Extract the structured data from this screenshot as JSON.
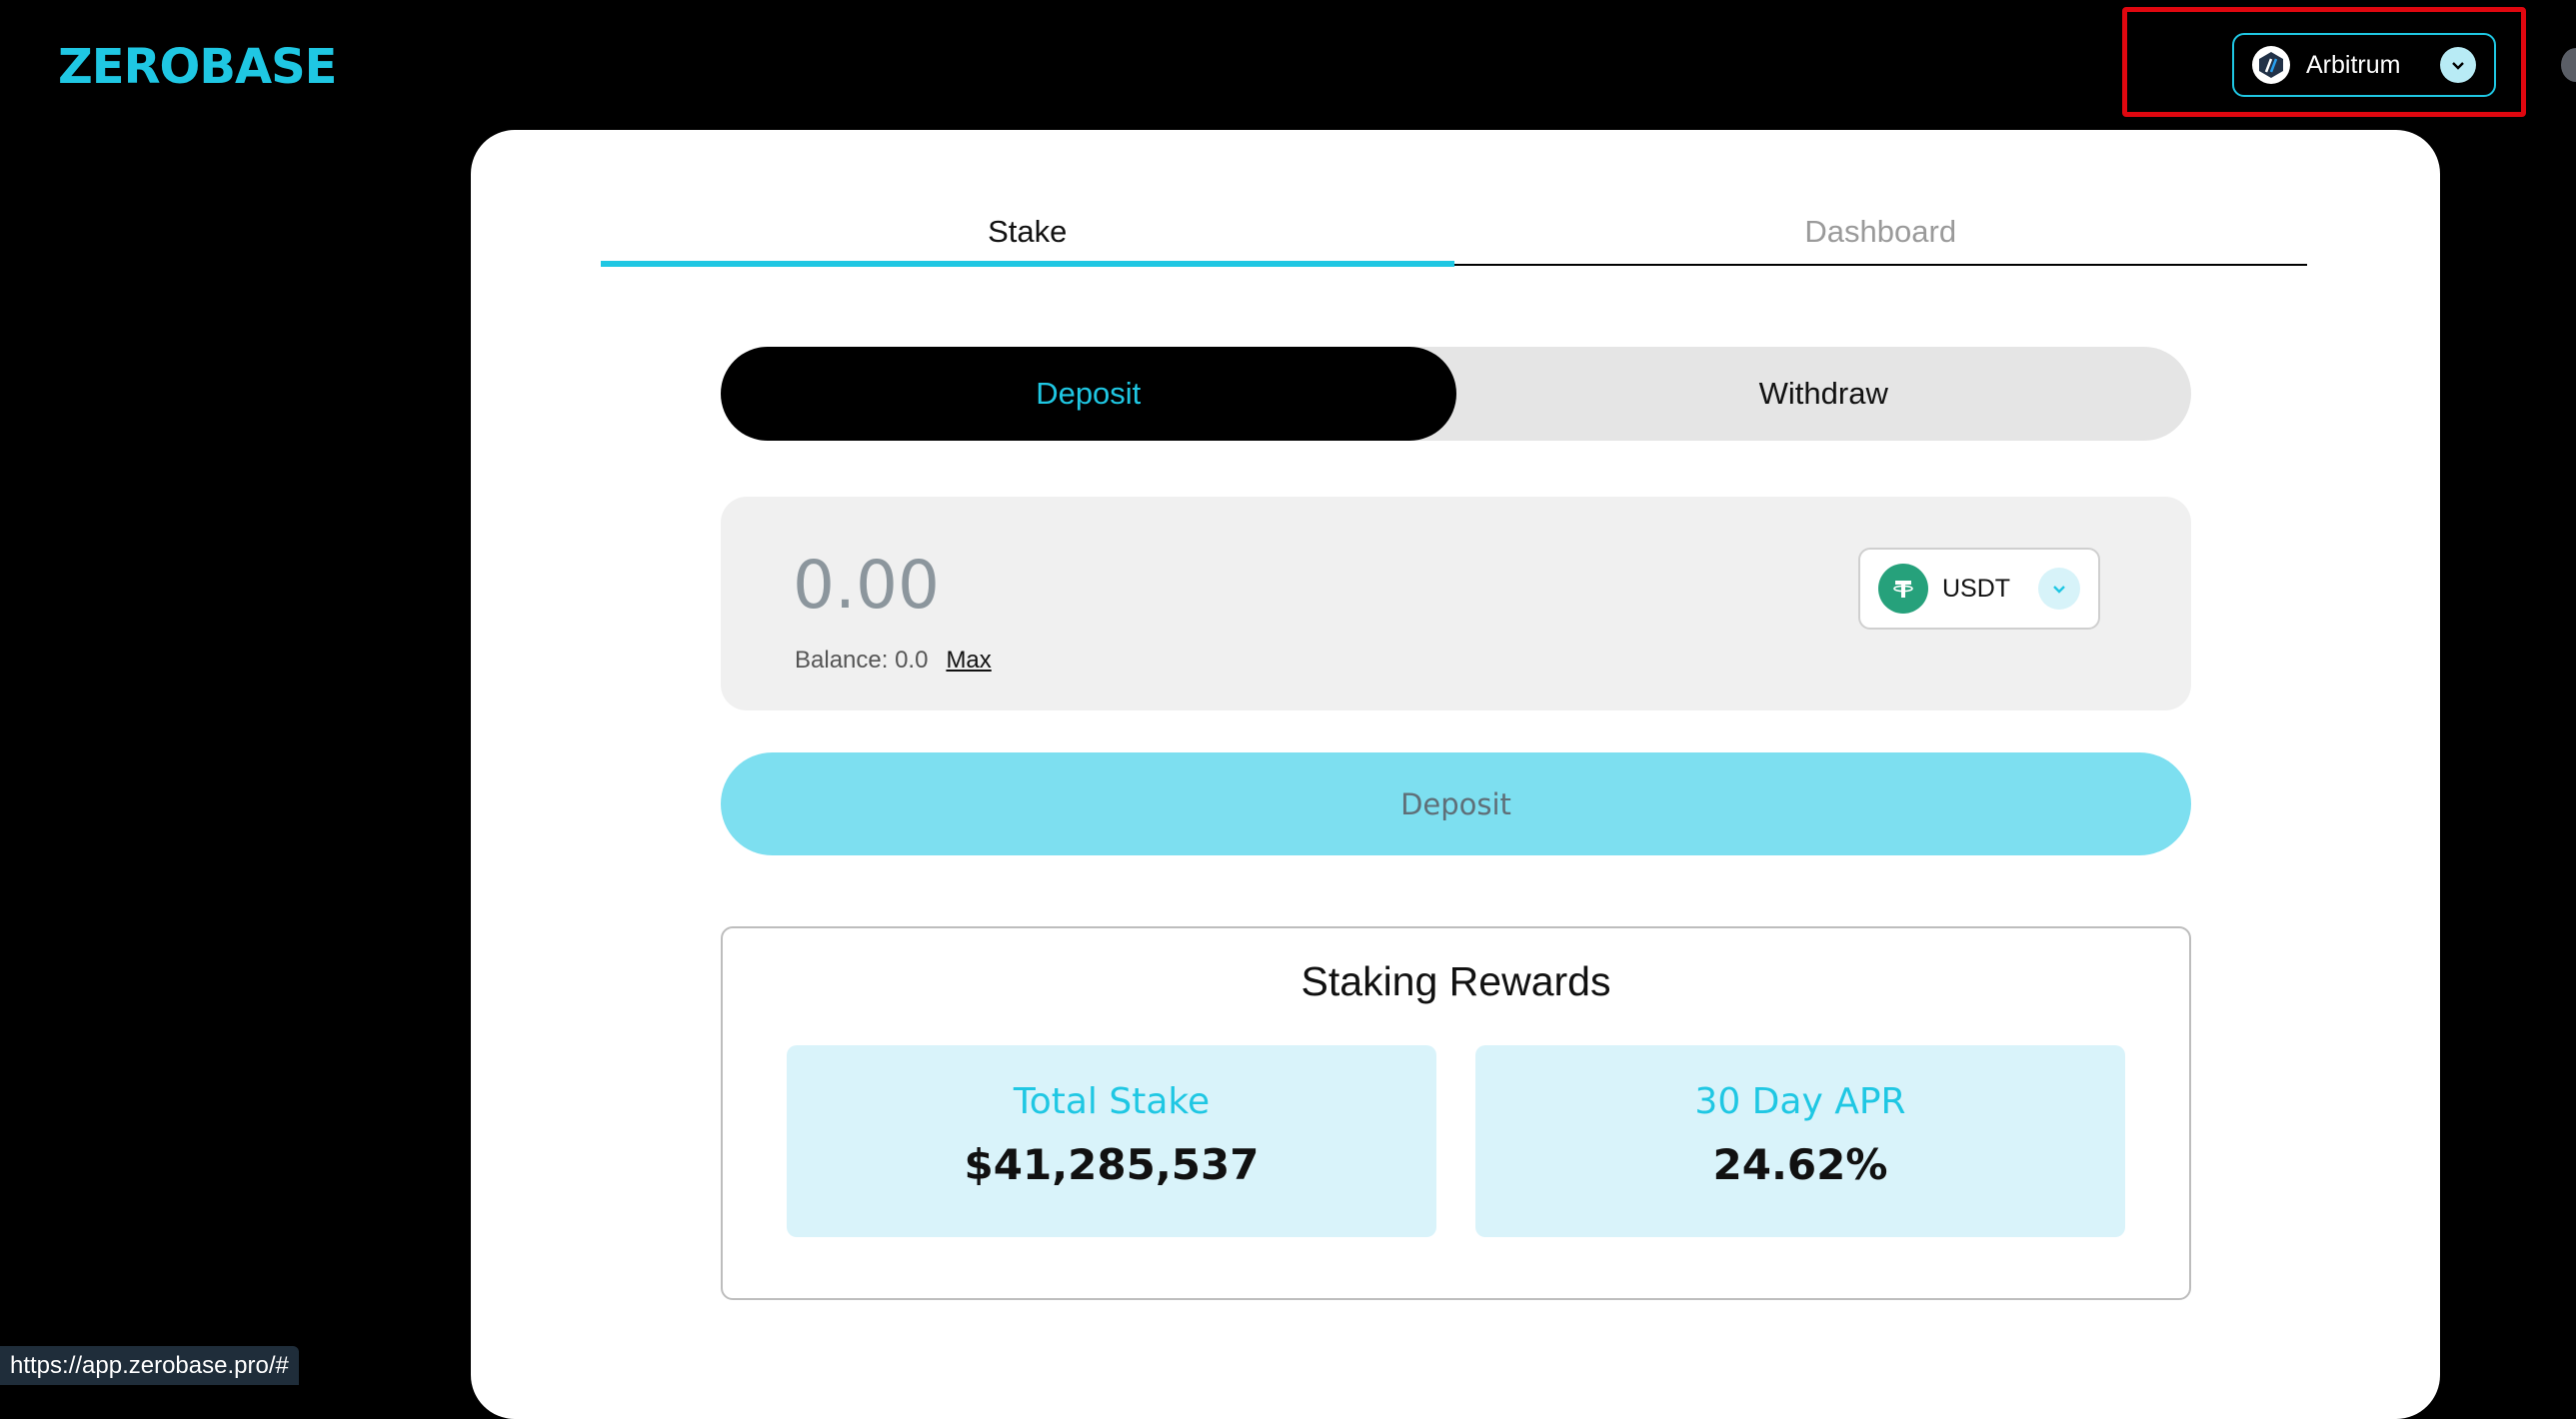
{
  "header": {
    "logo_text": "ZEROBASE",
    "network": {
      "label": "Arbitrum",
      "icon": "arbitrum-icon",
      "chevron_icon": "chevron-down-icon"
    }
  },
  "tabs": [
    {
      "label": "Stake",
      "active": true
    },
    {
      "label": "Dashboard",
      "active": false
    }
  ],
  "mode_toggle": [
    {
      "label": "Deposit",
      "active": true
    },
    {
      "label": "Withdraw",
      "active": false
    }
  ],
  "amount": {
    "placeholder": "0.00",
    "balance_label": "Balance: 0.0",
    "max_label": "Max",
    "token": {
      "label": "USDT",
      "icon": "tether-icon"
    }
  },
  "deposit_button": {
    "label": "Deposit"
  },
  "rewards": {
    "title": "Staking Rewards",
    "total_stake": {
      "label": "Total Stake",
      "value": "$41,285,537"
    },
    "apr": {
      "label": "30 Day APR",
      "value": "24.62%"
    }
  },
  "status_bar": {
    "url": "https://app.zerobase.pro/#"
  },
  "colors": {
    "accent": "#1fc7e3",
    "highlight": "#e0070f",
    "deposit_button": "#7ddff0",
    "stat_bg": "#d9f3fa"
  }
}
